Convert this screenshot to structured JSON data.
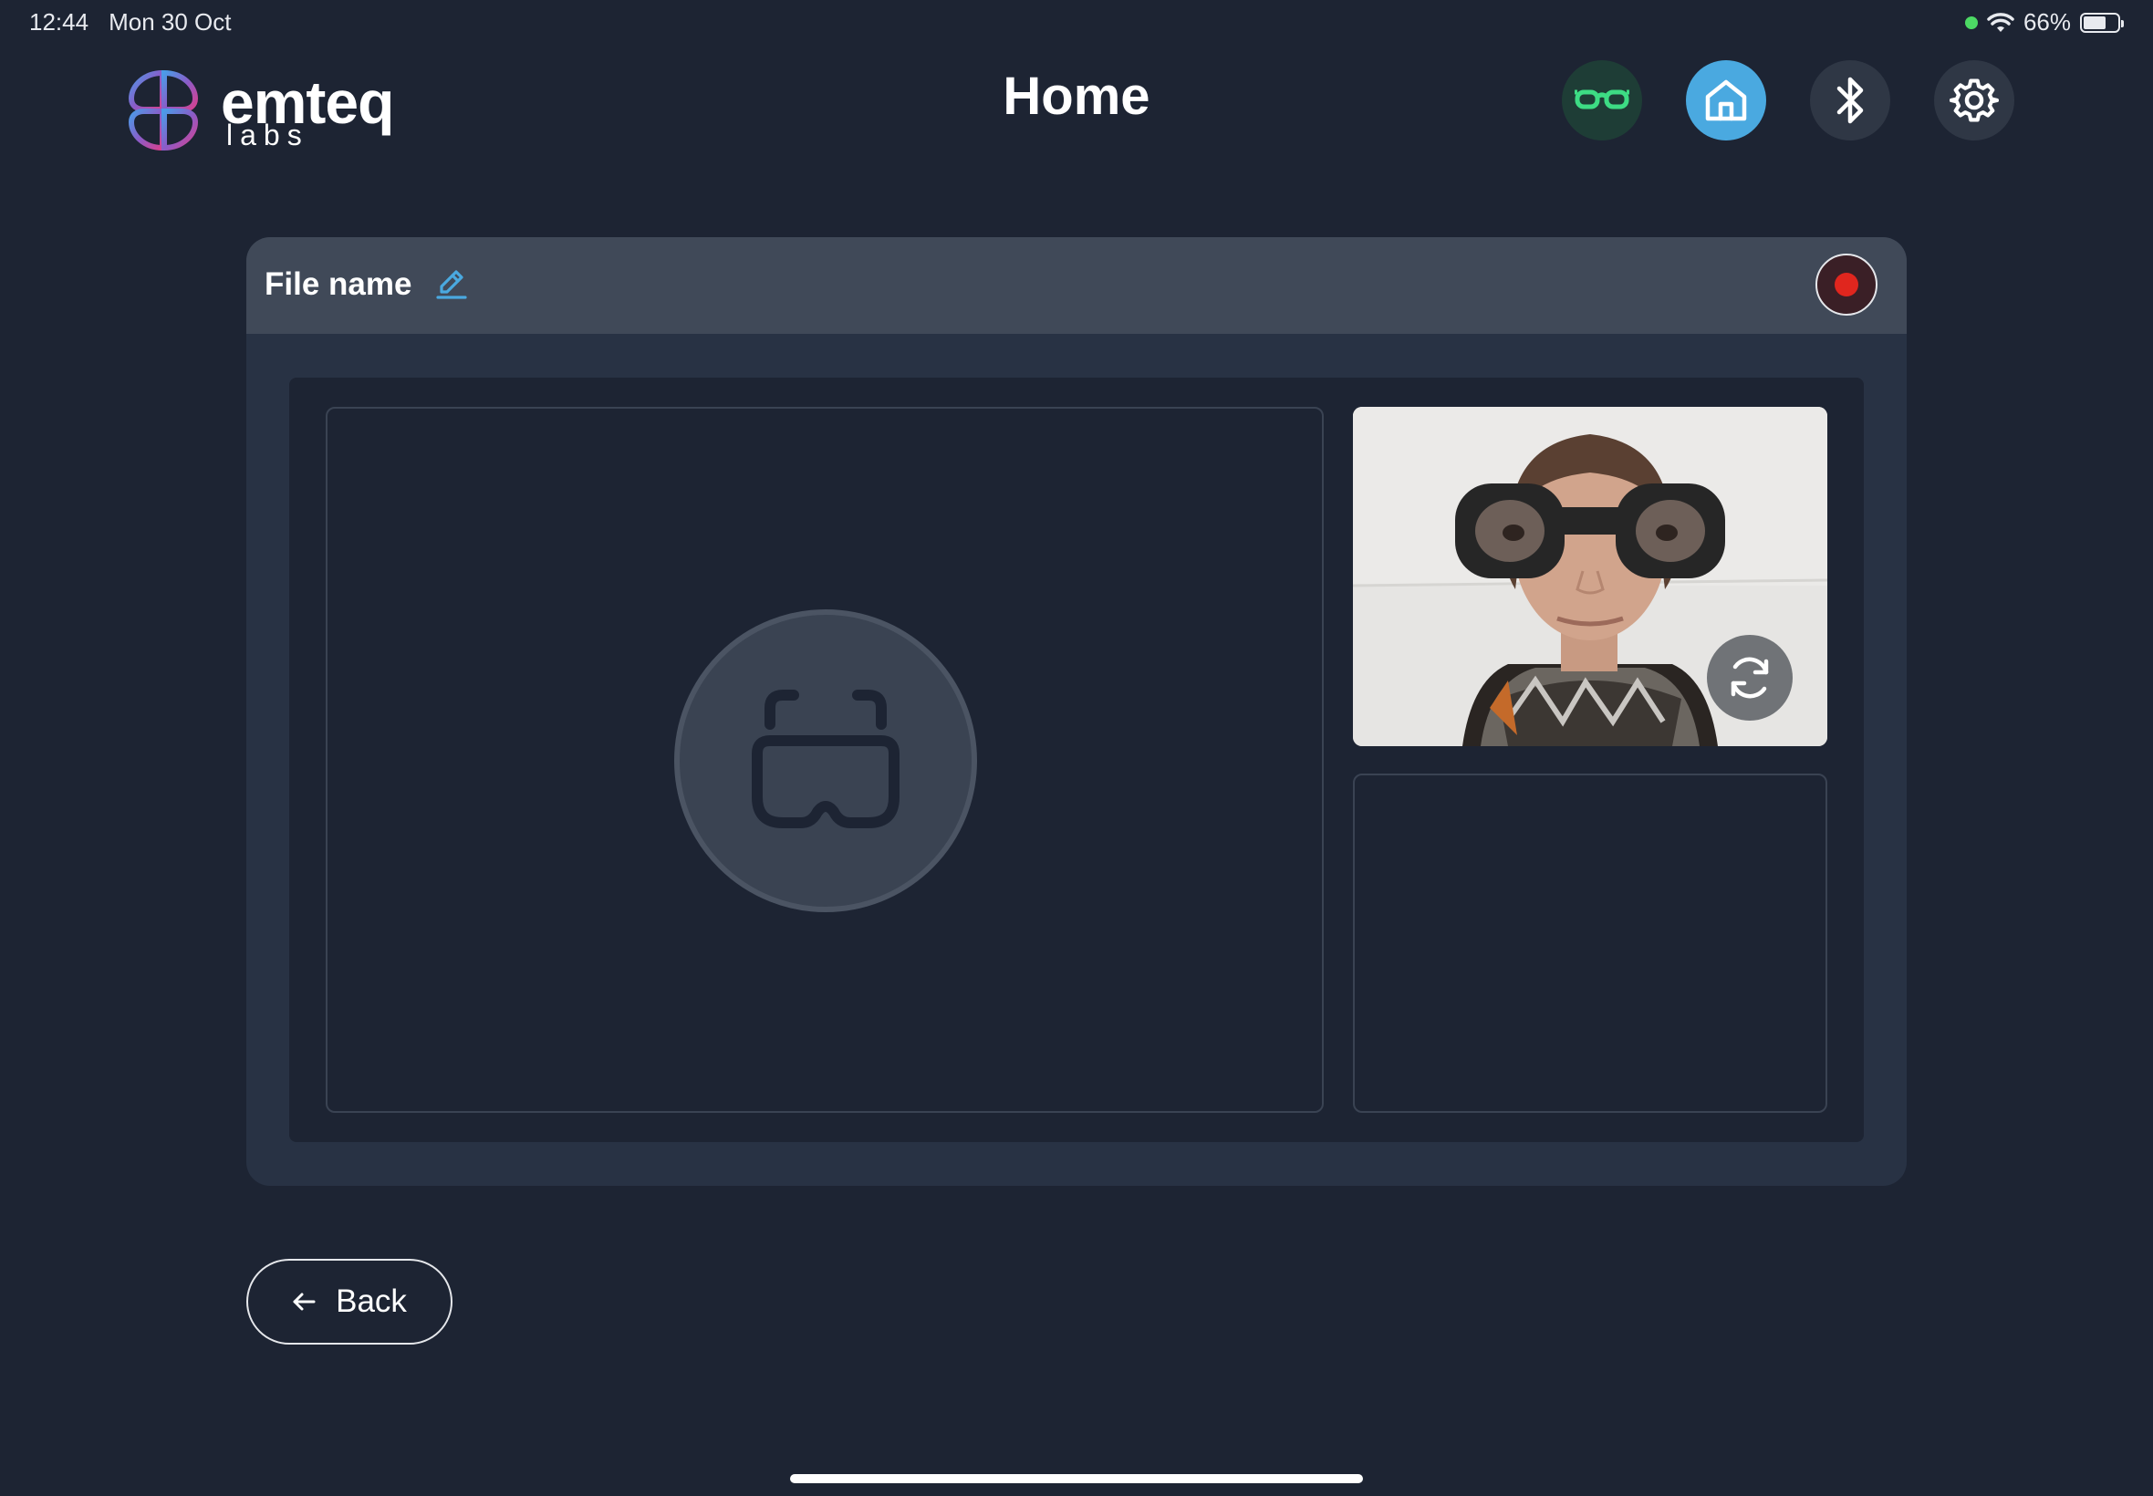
{
  "status_bar": {
    "time": "12:44",
    "date": "Mon 30 Oct",
    "battery_percent": "66%",
    "battery_level": 0.66,
    "wifi_icon": "wifi-icon",
    "indicator_color": "#4cd964"
  },
  "header": {
    "logo_word": "emteq",
    "logo_sub": "labs",
    "title": "Home",
    "icons": [
      "glasses-icon",
      "home-icon",
      "bluetooth-icon",
      "gear-icon"
    ],
    "active_icon": "home-icon",
    "accent_color": "#4aa9e0",
    "glasses_color": "#3ddc84"
  },
  "recording": {
    "file_name_label": "File name",
    "edit_icon": "pencil-icon",
    "record_icon": "record-icon",
    "record_color": "#e0261e"
  },
  "views": {
    "main_placeholder_icon": "vr-headset-icon",
    "camera_switch_icon": "camera-switch-icon"
  },
  "footer": {
    "back_label": "Back",
    "back_icon": "arrow-left-icon"
  }
}
